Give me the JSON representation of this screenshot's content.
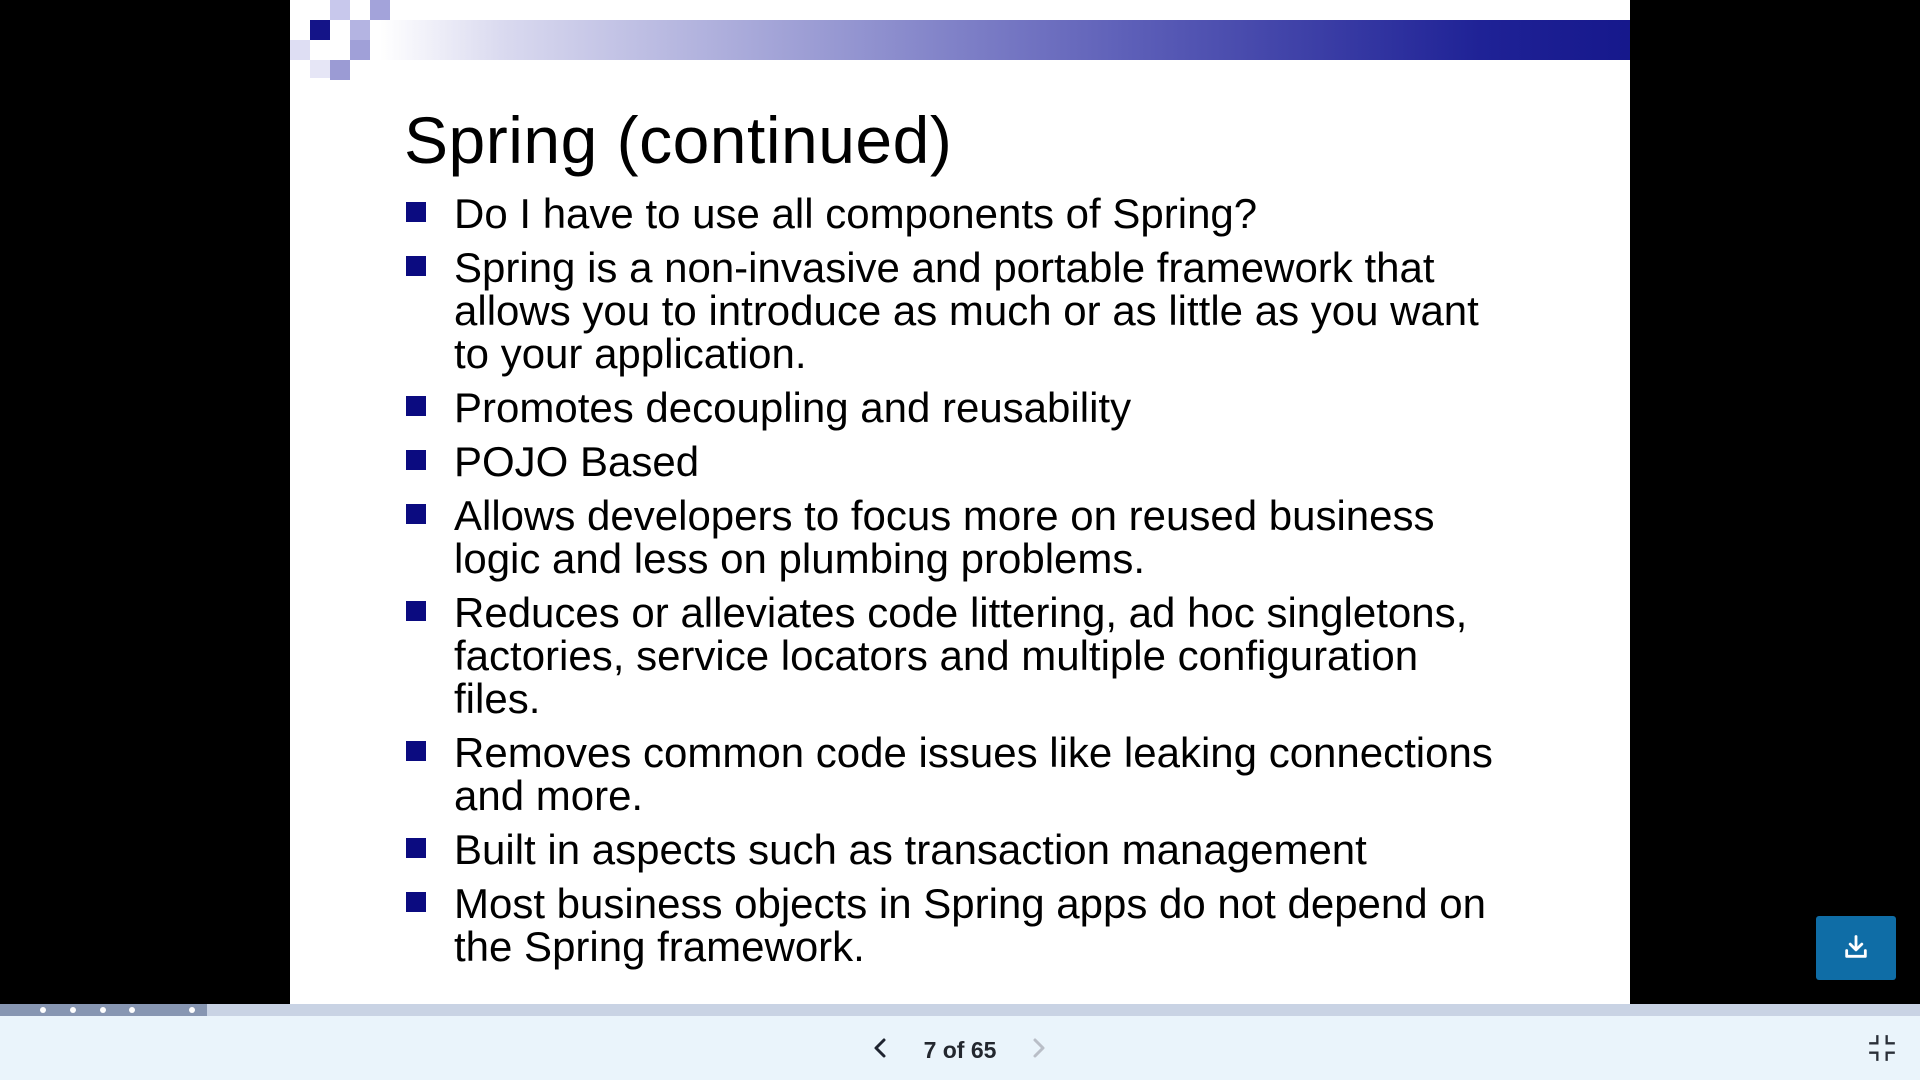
{
  "slide": {
    "title": "Spring (continued)",
    "bullets": [
      "Do I have to use all components of Spring?",
      "Spring is a non-invasive and portable framework that allows you to introduce as much or as little as you want to your application.",
      "Promotes decoupling and reusability",
      "POJO Based",
      "Allows developers to focus more on reused business logic and less on plumbing problems.",
      "Reduces or alleviates code littering, ad hoc singletons, factories, service locators and multiple configuration files.",
      "Removes common code issues like leaking connections and more.",
      "Built in aspects such as transaction management",
      "Most business objects in Spring apps do not depend on the Spring framework."
    ]
  },
  "toolbar": {
    "current_page": 7,
    "total_pages": 65,
    "page_indicator": "7 of 65",
    "prev_icon": "chevron-left-icon",
    "next_icon": "chevron-right-icon",
    "exit_icon": "exit-fullscreen-icon"
  },
  "download": {
    "icon": "download-icon"
  },
  "progress": {
    "current": 7,
    "total": 65
  },
  "colors": {
    "accent_blue": "#0f6da6",
    "toolbar_bg": "#eaf4fb",
    "bullet_navy": "#0b0b80",
    "progress_fill": "#8796b2",
    "progress_track": "#c9d3e4"
  }
}
